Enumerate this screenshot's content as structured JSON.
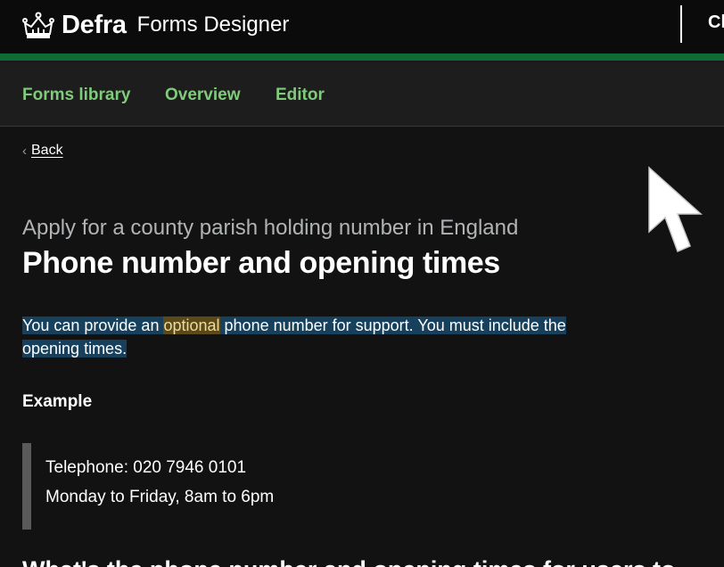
{
  "header": {
    "brand": "Defra",
    "service": "Forms Designer",
    "right_text": "Cl"
  },
  "nav": {
    "items": [
      {
        "label": "Forms library"
      },
      {
        "label": "Overview"
      },
      {
        "label": "Editor"
      }
    ]
  },
  "back": {
    "label": "Back"
  },
  "page": {
    "caption": "Apply for a county parish holding number in England",
    "title": "Phone number and opening times",
    "intro_before": "You can provide an ",
    "intro_highlight": "optional",
    "intro_after_line1": " phone number for support. You must include the",
    "intro_line2": "opening times.",
    "example_heading": "Example",
    "example_line1": "Telephone: 020 7946 0101",
    "example_line2": "Monday to Friday, 8am to 6pm",
    "cut_heading": "What's the phone number and opening times for users to"
  },
  "colors": {
    "accent": "#0f6b33",
    "nav_link": "#7fcb7b",
    "selection": "#16405c"
  }
}
